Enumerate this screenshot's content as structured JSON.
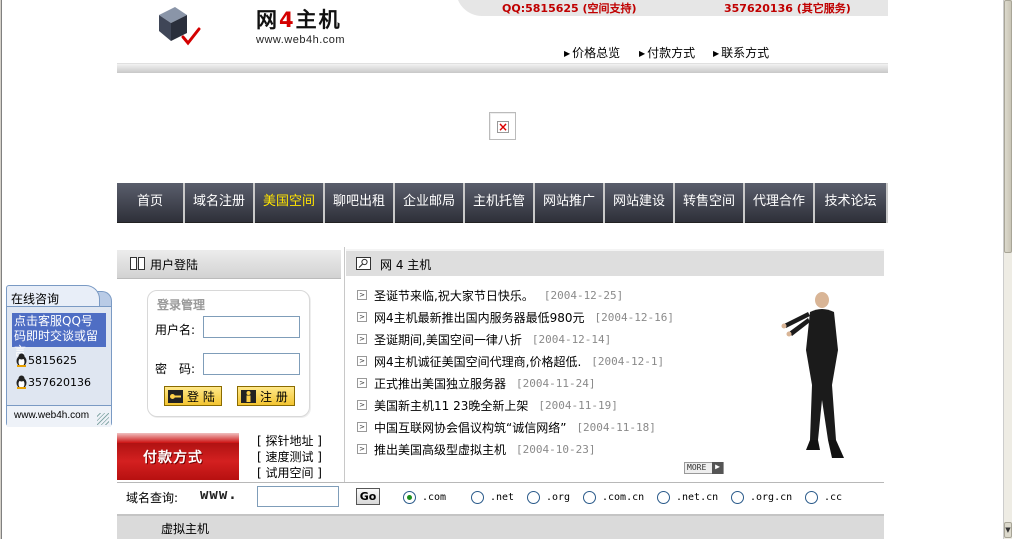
{
  "header": {
    "logo_text_a": "网",
    "logo_text_b": "4",
    "logo_text_c": "主机",
    "logo_url": "www.web4h.com",
    "contact_qq1": "QQ:5815625 (空间支持)",
    "contact_qq2": "357620136 (其它服务)",
    "links": [
      "价格总览",
      "付款方式",
      "联系方式"
    ]
  },
  "nav": {
    "items": [
      "首页",
      "域名注册",
      "美国空间",
      "聊吧出租",
      "企业邮局",
      "主机托管",
      "网站推广",
      "网站建设",
      "转售空间",
      "代理合作",
      "技术论坛"
    ],
    "active_index": 2,
    "active_color": "#ffe400"
  },
  "login": {
    "header_title": "用户登陆",
    "box_legend": "登录管理",
    "username_label": "用户名:",
    "password_label": "密　码:",
    "username_value": "",
    "password_value": "",
    "login_button": "登 陆",
    "register_button": "注 册"
  },
  "payment": {
    "banner_text": "付款方式",
    "links": [
      "[ 探针地址 ]",
      "[ 速度测试 ]",
      "[ 试用空间 ]"
    ]
  },
  "news": {
    "header_title": "网 4 主机",
    "items": [
      {
        "title": "圣诞节来临,祝大家节日快乐。",
        "date": "[2004-12-25]"
      },
      {
        "title": "网4主机最新推出国内服务器最低980元",
        "date": "[2004-12-16]"
      },
      {
        "title": "圣诞期间,美国空间一律八折",
        "date": "[2004-12-14]"
      },
      {
        "title": "网4主机诚征美国空间代理商,价格超低.",
        "date": "[2004-12-1]"
      },
      {
        "title": "正式推出美国独立服务器",
        "date": "[2004-11-24]"
      },
      {
        "title": "美国新主机11 23晚全新上架",
        "date": "[2004-11-19]"
      },
      {
        "title": "中国互联网协会倡议构筑“诚信网络”",
        "date": "[2004-11-18]"
      },
      {
        "title": "推出美国高级型虚拟主机",
        "date": "[2004-10-23]"
      }
    ],
    "more_label": "MORE"
  },
  "domain_query": {
    "label": "域名查询:",
    "www": "www.",
    "input_value": "",
    "go_label": "Go",
    "tlds": [
      ".com",
      ".net",
      ".org",
      ".com.cn",
      ".net.cn",
      ".org.cn",
      ".cc"
    ],
    "selected_index": 0
  },
  "section_bar": {
    "title": "虚拟主机"
  },
  "consult": {
    "tab_title": "在线咨询",
    "message": "点击客服QQ号码即时交谈或留言",
    "qq1": "5815625",
    "qq2": "357620136",
    "footer": "www.web4h.com"
  }
}
